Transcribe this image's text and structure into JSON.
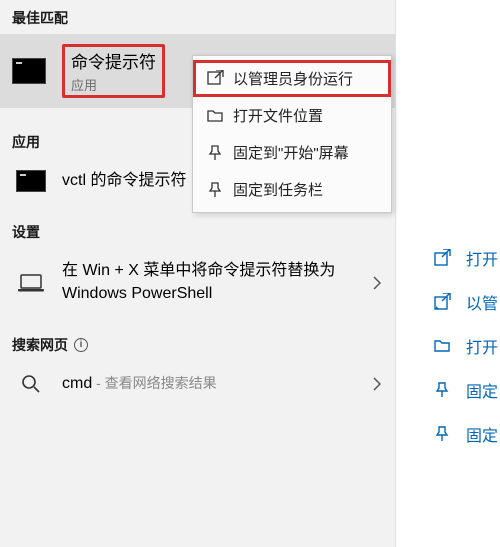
{
  "left": {
    "section_best": "最佳匹配",
    "best_match": {
      "title": "命令提示符",
      "subtitle": "应用"
    },
    "section_apps": "应用",
    "app_item": "vctl 的命令提示符",
    "section_settings": "设置",
    "settings_item": "在 Win + X 菜单中将命令提示符替换为 Windows PowerShell",
    "section_web": "搜索网页",
    "web_query": "cmd",
    "web_hint": " - 查看网络搜索结果"
  },
  "context_menu": {
    "items": [
      {
        "label": "以管理员身份运行",
        "icon": "admin-shield-icon"
      },
      {
        "label": "打开文件位置",
        "icon": "folder-open-icon"
      },
      {
        "label": "固定到\"开始\"屏幕",
        "icon": "pin-icon"
      },
      {
        "label": "固定到任务栏",
        "icon": "pin-taskbar-icon"
      }
    ]
  },
  "right": {
    "items": [
      {
        "label": "打开",
        "icon": "open-icon"
      },
      {
        "label": "以管",
        "icon": "admin-shield-icon"
      },
      {
        "label": "打开",
        "icon": "folder-open-icon"
      },
      {
        "label": "固定",
        "icon": "pin-icon"
      },
      {
        "label": "固定",
        "icon": "pin-taskbar-icon"
      }
    ]
  }
}
